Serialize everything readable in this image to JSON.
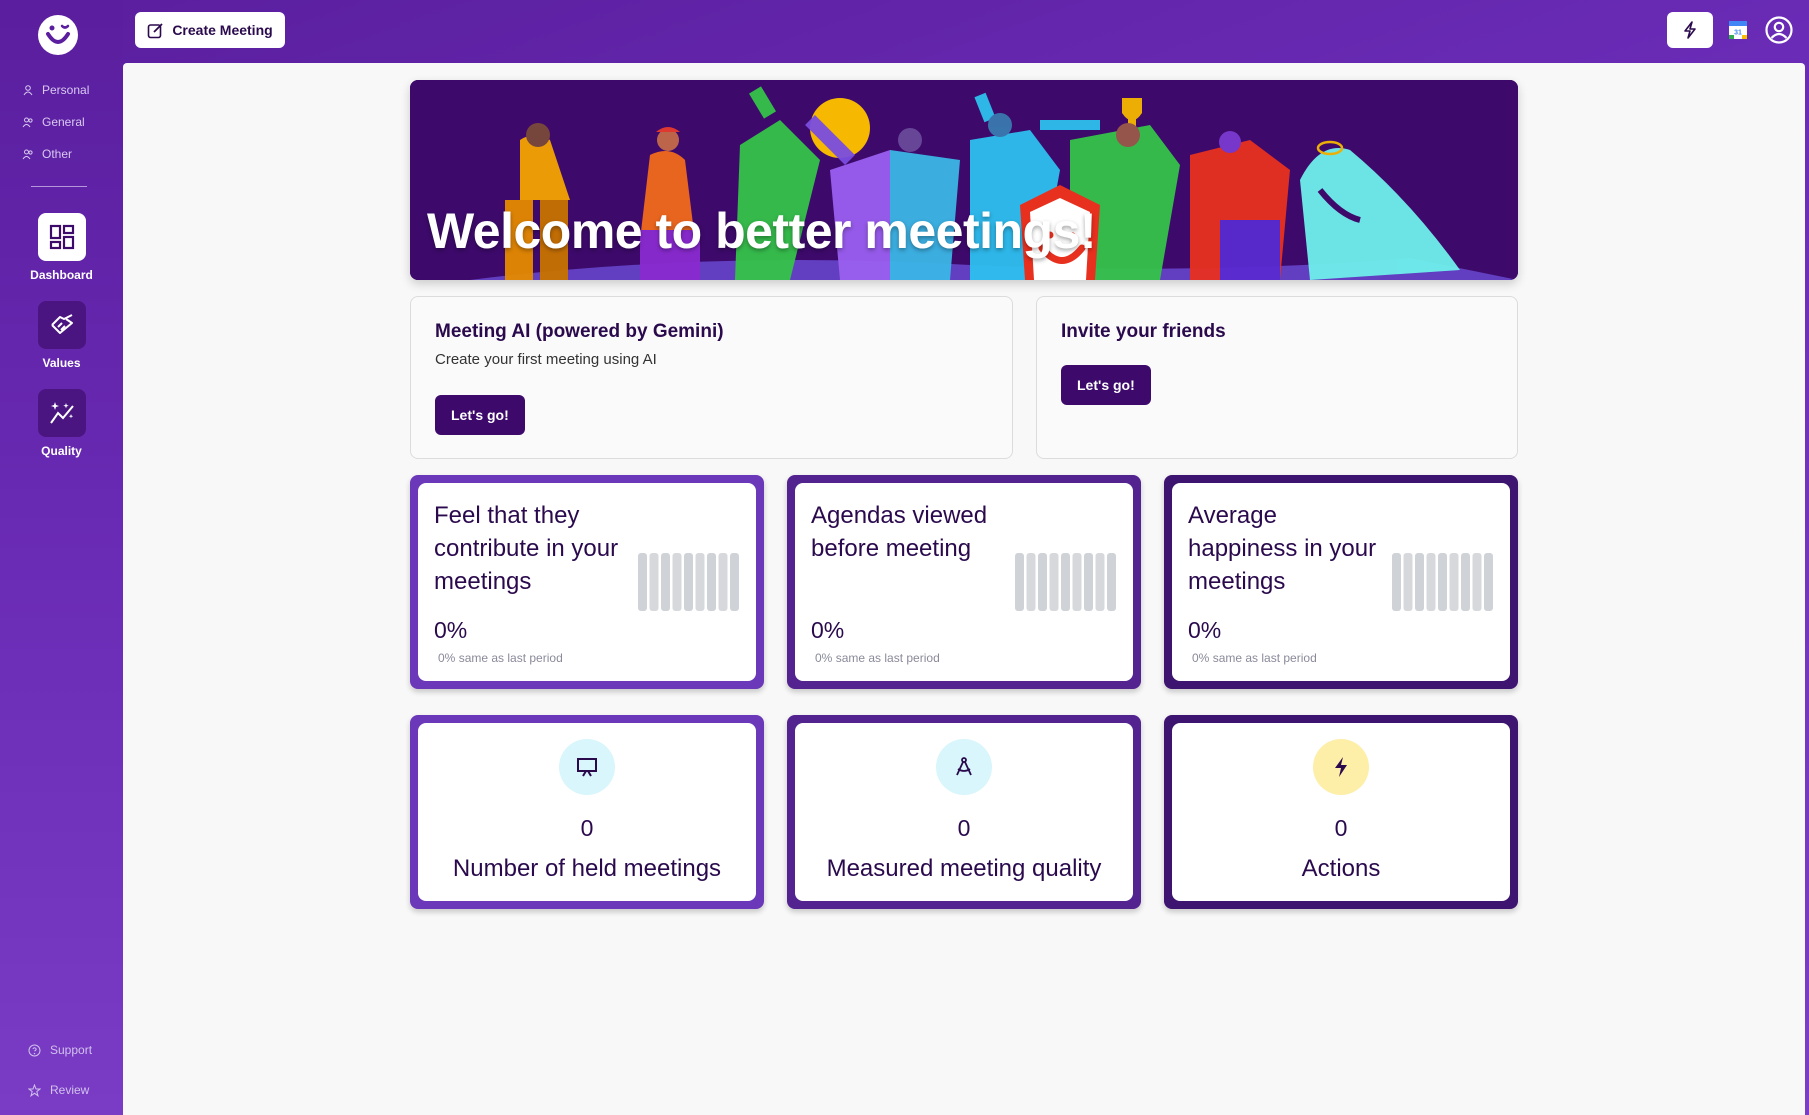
{
  "sidebar": {
    "scopes": [
      {
        "label": "Personal",
        "icon": "person-icon"
      },
      {
        "label": "General",
        "icon": "people-icon"
      },
      {
        "label": "Other",
        "icon": "people-icon"
      }
    ],
    "nav": [
      {
        "label": "Dashboard",
        "icon": "dashboard-icon",
        "active": true
      },
      {
        "label": "Values",
        "icon": "handshake-icon",
        "active": false
      },
      {
        "label": "Quality",
        "icon": "sparkle-chart-icon",
        "active": false
      }
    ],
    "bottom": [
      {
        "label": "Support",
        "icon": "help-icon"
      },
      {
        "label": "Review",
        "icon": "star-icon"
      }
    ]
  },
  "topbar": {
    "create_label": "Create Meeting",
    "quick_icon": "bolt-icon",
    "calendar_icon": "google-calendar-icon",
    "account_icon": "account-icon"
  },
  "banner": {
    "title": "Welcome to better meetings!"
  },
  "ai_card": {
    "title": "Meeting AI (powered by Gemini)",
    "subtitle": "Create your first meeting using AI",
    "button": "Let's go!"
  },
  "invite_card": {
    "title": "Invite your friends",
    "button": "Let's go!"
  },
  "stats": [
    {
      "title": "Feel that they contribute in your meetings",
      "value": "0%",
      "change": "0%",
      "note": "same as last period"
    },
    {
      "title": "Agendas viewed before meeting",
      "value": "0%",
      "change": "0%",
      "note": "same as last period"
    },
    {
      "title": "Average happiness in your meetings",
      "value": "0%",
      "change": "0%",
      "note": "same as last period"
    }
  ],
  "counts": [
    {
      "value": "0",
      "label": "Number of held meetings",
      "icon": "presentation-icon",
      "icon_bg": "#d8f6fb"
    },
    {
      "value": "0",
      "label": "Measured meeting quality",
      "icon": "compass-icon",
      "icon_bg": "#d8f6fb"
    },
    {
      "value": "0",
      "label": "Actions",
      "icon": "bolt-icon",
      "icon_bg": "#fdeea8"
    }
  ],
  "colors": {
    "brand_dark": "#3d0a6b",
    "brand": "#5a1e9e",
    "text_dark": "#2a0a4d"
  }
}
